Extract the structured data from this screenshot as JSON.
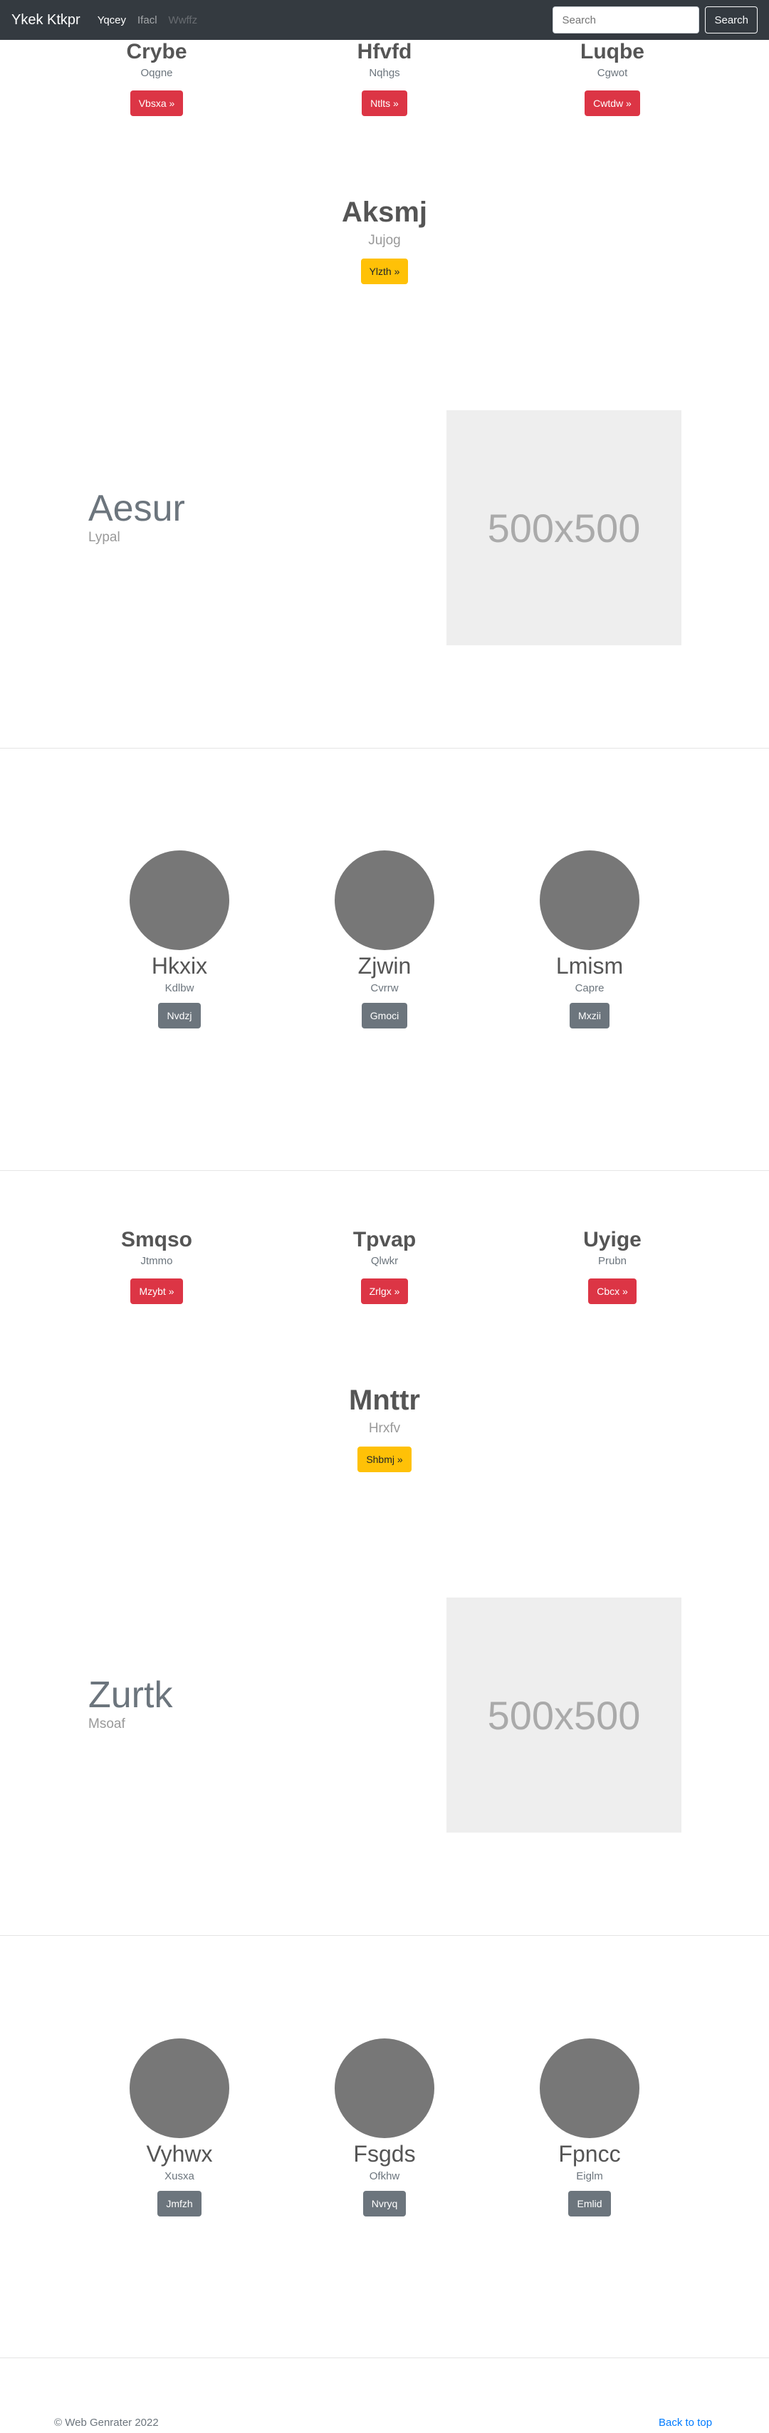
{
  "navbar": {
    "brand": "Ykek Ktkpr",
    "links": [
      "Yqcey",
      "Ifacl",
      "Wwffz"
    ],
    "search_placeholder": "Search",
    "search_button": "Search"
  },
  "section1": {
    "cols": [
      {
        "title": "Crybe",
        "sub": "Oqgne",
        "button": "Vbsxa »"
      },
      {
        "title": "Hfvfd",
        "sub": "Nqhgs",
        "button": "Ntlts »"
      },
      {
        "title": "Luqbe",
        "sub": "Cgwot",
        "button": "Cwtdw »"
      }
    ],
    "feature": {
      "title": "Aksmj",
      "sub": "Jujog",
      "button": "Ylzth »"
    }
  },
  "hero1": {
    "title": "Aesur",
    "sub": "Lypal",
    "image_label": "500x500"
  },
  "circles1": [
    {
      "name": "Hkxix",
      "sub": "Kdlbw",
      "button": "Nvdzj"
    },
    {
      "name": "Zjwin",
      "sub": "Cvrrw",
      "button": "Gmoci"
    },
    {
      "name": "Lmism",
      "sub": "Capre",
      "button": "Mxzii"
    }
  ],
  "section2": {
    "cols": [
      {
        "title": "Smqso",
        "sub": "Jtmmo",
        "button": "Mzybt »"
      },
      {
        "title": "Tpvap",
        "sub": "Qlwkr",
        "button": "Zrlgx »"
      },
      {
        "title": "Uyige",
        "sub": "Prubn",
        "button": "Cbcx »"
      }
    ],
    "feature": {
      "title": "Mnttr",
      "sub": "Hrxfv",
      "button": "Shbmj »"
    }
  },
  "hero2": {
    "title": "Zurtk",
    "sub": "Msoaf",
    "image_label": "500x500"
  },
  "circles2": [
    {
      "name": "Vyhwx",
      "sub": "Xusxa",
      "button": "Jmfzh"
    },
    {
      "name": "Fsgds",
      "sub": "Ofkhw",
      "button": "Nvryq"
    },
    {
      "name": "Fpncc",
      "sub": "Eiglm",
      "button": "Emlid"
    }
  ],
  "footer": {
    "copyright": "© Web Genrater 2022",
    "back_to_top": "Back to top"
  },
  "colors": {
    "navbar": "#343a40",
    "red": "#dc3545",
    "yellow": "#ffc107",
    "gray": "#6c757d",
    "link": "#007bff"
  }
}
